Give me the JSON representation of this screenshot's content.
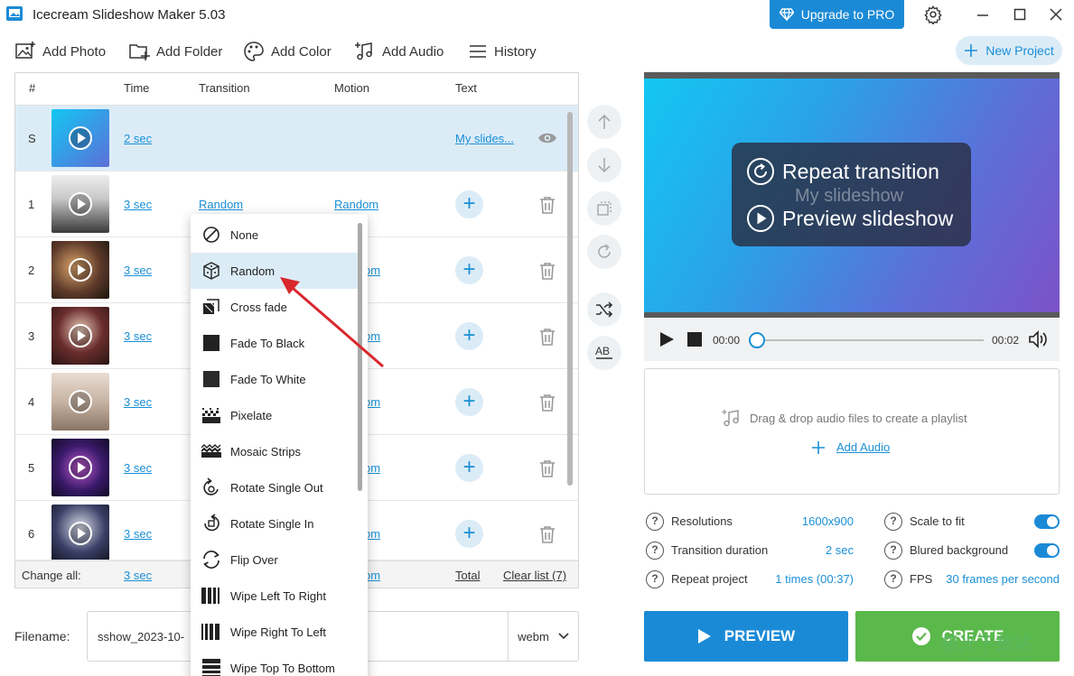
{
  "app": {
    "title": "Icecream Slideshow Maker 5.03",
    "upgrade_label": "Upgrade to PRO"
  },
  "toolbar": {
    "add_photo": "Add Photo",
    "add_folder": "Add Folder",
    "add_color": "Add Color",
    "add_audio": "Add Audio",
    "history": "History",
    "new_project": "New Project"
  },
  "table": {
    "headers": {
      "num": "#",
      "time": "Time",
      "transition": "Transition",
      "motion": "Motion",
      "text": "Text"
    },
    "start_row": {
      "index": "S",
      "time": "2 sec",
      "text": "My slides..."
    },
    "rows": [
      {
        "index": "1",
        "time": "3 sec",
        "transition": "Random",
        "motion": "Random"
      },
      {
        "index": "2",
        "time": "3 sec",
        "motion_partial": "om"
      },
      {
        "index": "3",
        "time": "3 sec",
        "motion_partial": "om"
      },
      {
        "index": "4",
        "time": "3 sec",
        "motion_partial": "om"
      },
      {
        "index": "5",
        "time": "3 sec",
        "motion_partial": "om"
      },
      {
        "index": "6",
        "time": "3 sec",
        "motion_partial": "om"
      }
    ],
    "footer": {
      "change_all": "Change all:",
      "time": "3 sec",
      "motion_partial": "om",
      "total": "Total",
      "clear_list": "Clear list (7)"
    }
  },
  "dropdown": {
    "items": [
      {
        "label": "None",
        "icon": "none-icon"
      },
      {
        "label": "Random",
        "icon": "dice-icon"
      },
      {
        "label": "Cross fade",
        "icon": "cross-fade-icon"
      },
      {
        "label": "Fade To Black",
        "icon": "fade-black-icon"
      },
      {
        "label": "Fade To White",
        "icon": "fade-white-icon"
      },
      {
        "label": "Pixelate",
        "icon": "pixelate-icon"
      },
      {
        "label": "Mosaic Strips",
        "icon": "mosaic-icon"
      },
      {
        "label": "Rotate Single Out",
        "icon": "rotate-out-icon"
      },
      {
        "label": "Rotate Single In",
        "icon": "rotate-in-icon"
      },
      {
        "label": "Flip Over",
        "icon": "flip-icon"
      },
      {
        "label": "Wipe Left To Right",
        "icon": "wipe-lr-icon"
      },
      {
        "label": "Wipe Right To Left",
        "icon": "wipe-rl-icon"
      },
      {
        "label": "Wipe Top To Bottom",
        "icon": "wipe-tb-icon"
      }
    ],
    "highlighted": "Random"
  },
  "filename": {
    "label": "Filename:",
    "value": "sshow_2023-10-",
    "format": "webm"
  },
  "preview": {
    "repeat_label": "Repeat transition",
    "overlay_text": "My slideshow",
    "preview_label": "Preview slideshow",
    "time_current": "00:00",
    "time_total": "00:02",
    "seek_fraction": 0
  },
  "audio": {
    "hint": "Drag & drop audio files to create a playlist",
    "add_label": "Add Audio"
  },
  "settings": {
    "resolutions": {
      "label": "Resolutions",
      "value": "1600x900"
    },
    "transition_duration": {
      "label": "Transition duration",
      "value": "2 sec"
    },
    "repeat_project": {
      "label": "Repeat project",
      "value": "1 times (00:37)"
    },
    "scale_to_fit": {
      "label": "Scale to fit",
      "on": true
    },
    "blured_background": {
      "label": "Blured background",
      "on": true
    },
    "fps": {
      "label": "FPS",
      "value": "30 frames per second"
    }
  },
  "actions": {
    "preview": "PREVIEW",
    "create": "CREATE"
  },
  "watermark": {
    "text": "极光下载站",
    "url": "www.xz7.com"
  },
  "colors": {
    "accent": "#1b8ad6",
    "create_green": "#5bb84a",
    "selection": "#dcecf7",
    "arrow_red": "#d9272e"
  }
}
